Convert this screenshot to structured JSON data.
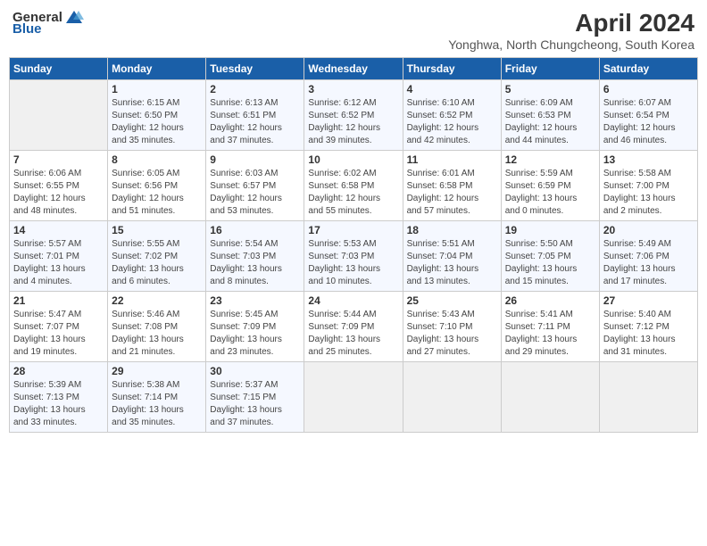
{
  "logo": {
    "general": "General",
    "blue": "Blue"
  },
  "title": "April 2024",
  "location": "Yonghwa, North Chungcheong, South Korea",
  "days_header": [
    "Sunday",
    "Monday",
    "Tuesday",
    "Wednesday",
    "Thursday",
    "Friday",
    "Saturday"
  ],
  "weeks": [
    [
      {
        "day": "",
        "info": ""
      },
      {
        "day": "1",
        "info": "Sunrise: 6:15 AM\nSunset: 6:50 PM\nDaylight: 12 hours\nand 35 minutes."
      },
      {
        "day": "2",
        "info": "Sunrise: 6:13 AM\nSunset: 6:51 PM\nDaylight: 12 hours\nand 37 minutes."
      },
      {
        "day": "3",
        "info": "Sunrise: 6:12 AM\nSunset: 6:52 PM\nDaylight: 12 hours\nand 39 minutes."
      },
      {
        "day": "4",
        "info": "Sunrise: 6:10 AM\nSunset: 6:52 PM\nDaylight: 12 hours\nand 42 minutes."
      },
      {
        "day": "5",
        "info": "Sunrise: 6:09 AM\nSunset: 6:53 PM\nDaylight: 12 hours\nand 44 minutes."
      },
      {
        "day": "6",
        "info": "Sunrise: 6:07 AM\nSunset: 6:54 PM\nDaylight: 12 hours\nand 46 minutes."
      }
    ],
    [
      {
        "day": "7",
        "info": "Sunrise: 6:06 AM\nSunset: 6:55 PM\nDaylight: 12 hours\nand 48 minutes."
      },
      {
        "day": "8",
        "info": "Sunrise: 6:05 AM\nSunset: 6:56 PM\nDaylight: 12 hours\nand 51 minutes."
      },
      {
        "day": "9",
        "info": "Sunrise: 6:03 AM\nSunset: 6:57 PM\nDaylight: 12 hours\nand 53 minutes."
      },
      {
        "day": "10",
        "info": "Sunrise: 6:02 AM\nSunset: 6:58 PM\nDaylight: 12 hours\nand 55 minutes."
      },
      {
        "day": "11",
        "info": "Sunrise: 6:01 AM\nSunset: 6:58 PM\nDaylight: 12 hours\nand 57 minutes."
      },
      {
        "day": "12",
        "info": "Sunrise: 5:59 AM\nSunset: 6:59 PM\nDaylight: 13 hours\nand 0 minutes."
      },
      {
        "day": "13",
        "info": "Sunrise: 5:58 AM\nSunset: 7:00 PM\nDaylight: 13 hours\nand 2 minutes."
      }
    ],
    [
      {
        "day": "14",
        "info": "Sunrise: 5:57 AM\nSunset: 7:01 PM\nDaylight: 13 hours\nand 4 minutes."
      },
      {
        "day": "15",
        "info": "Sunrise: 5:55 AM\nSunset: 7:02 PM\nDaylight: 13 hours\nand 6 minutes."
      },
      {
        "day": "16",
        "info": "Sunrise: 5:54 AM\nSunset: 7:03 PM\nDaylight: 13 hours\nand 8 minutes."
      },
      {
        "day": "17",
        "info": "Sunrise: 5:53 AM\nSunset: 7:03 PM\nDaylight: 13 hours\nand 10 minutes."
      },
      {
        "day": "18",
        "info": "Sunrise: 5:51 AM\nSunset: 7:04 PM\nDaylight: 13 hours\nand 13 minutes."
      },
      {
        "day": "19",
        "info": "Sunrise: 5:50 AM\nSunset: 7:05 PM\nDaylight: 13 hours\nand 15 minutes."
      },
      {
        "day": "20",
        "info": "Sunrise: 5:49 AM\nSunset: 7:06 PM\nDaylight: 13 hours\nand 17 minutes."
      }
    ],
    [
      {
        "day": "21",
        "info": "Sunrise: 5:47 AM\nSunset: 7:07 PM\nDaylight: 13 hours\nand 19 minutes."
      },
      {
        "day": "22",
        "info": "Sunrise: 5:46 AM\nSunset: 7:08 PM\nDaylight: 13 hours\nand 21 minutes."
      },
      {
        "day": "23",
        "info": "Sunrise: 5:45 AM\nSunset: 7:09 PM\nDaylight: 13 hours\nand 23 minutes."
      },
      {
        "day": "24",
        "info": "Sunrise: 5:44 AM\nSunset: 7:09 PM\nDaylight: 13 hours\nand 25 minutes."
      },
      {
        "day": "25",
        "info": "Sunrise: 5:43 AM\nSunset: 7:10 PM\nDaylight: 13 hours\nand 27 minutes."
      },
      {
        "day": "26",
        "info": "Sunrise: 5:41 AM\nSunset: 7:11 PM\nDaylight: 13 hours\nand 29 minutes."
      },
      {
        "day": "27",
        "info": "Sunrise: 5:40 AM\nSunset: 7:12 PM\nDaylight: 13 hours\nand 31 minutes."
      }
    ],
    [
      {
        "day": "28",
        "info": "Sunrise: 5:39 AM\nSunset: 7:13 PM\nDaylight: 13 hours\nand 33 minutes."
      },
      {
        "day": "29",
        "info": "Sunrise: 5:38 AM\nSunset: 7:14 PM\nDaylight: 13 hours\nand 35 minutes."
      },
      {
        "day": "30",
        "info": "Sunrise: 5:37 AM\nSunset: 7:15 PM\nDaylight: 13 hours\nand 37 minutes."
      },
      {
        "day": "",
        "info": ""
      },
      {
        "day": "",
        "info": ""
      },
      {
        "day": "",
        "info": ""
      },
      {
        "day": "",
        "info": ""
      }
    ]
  ]
}
